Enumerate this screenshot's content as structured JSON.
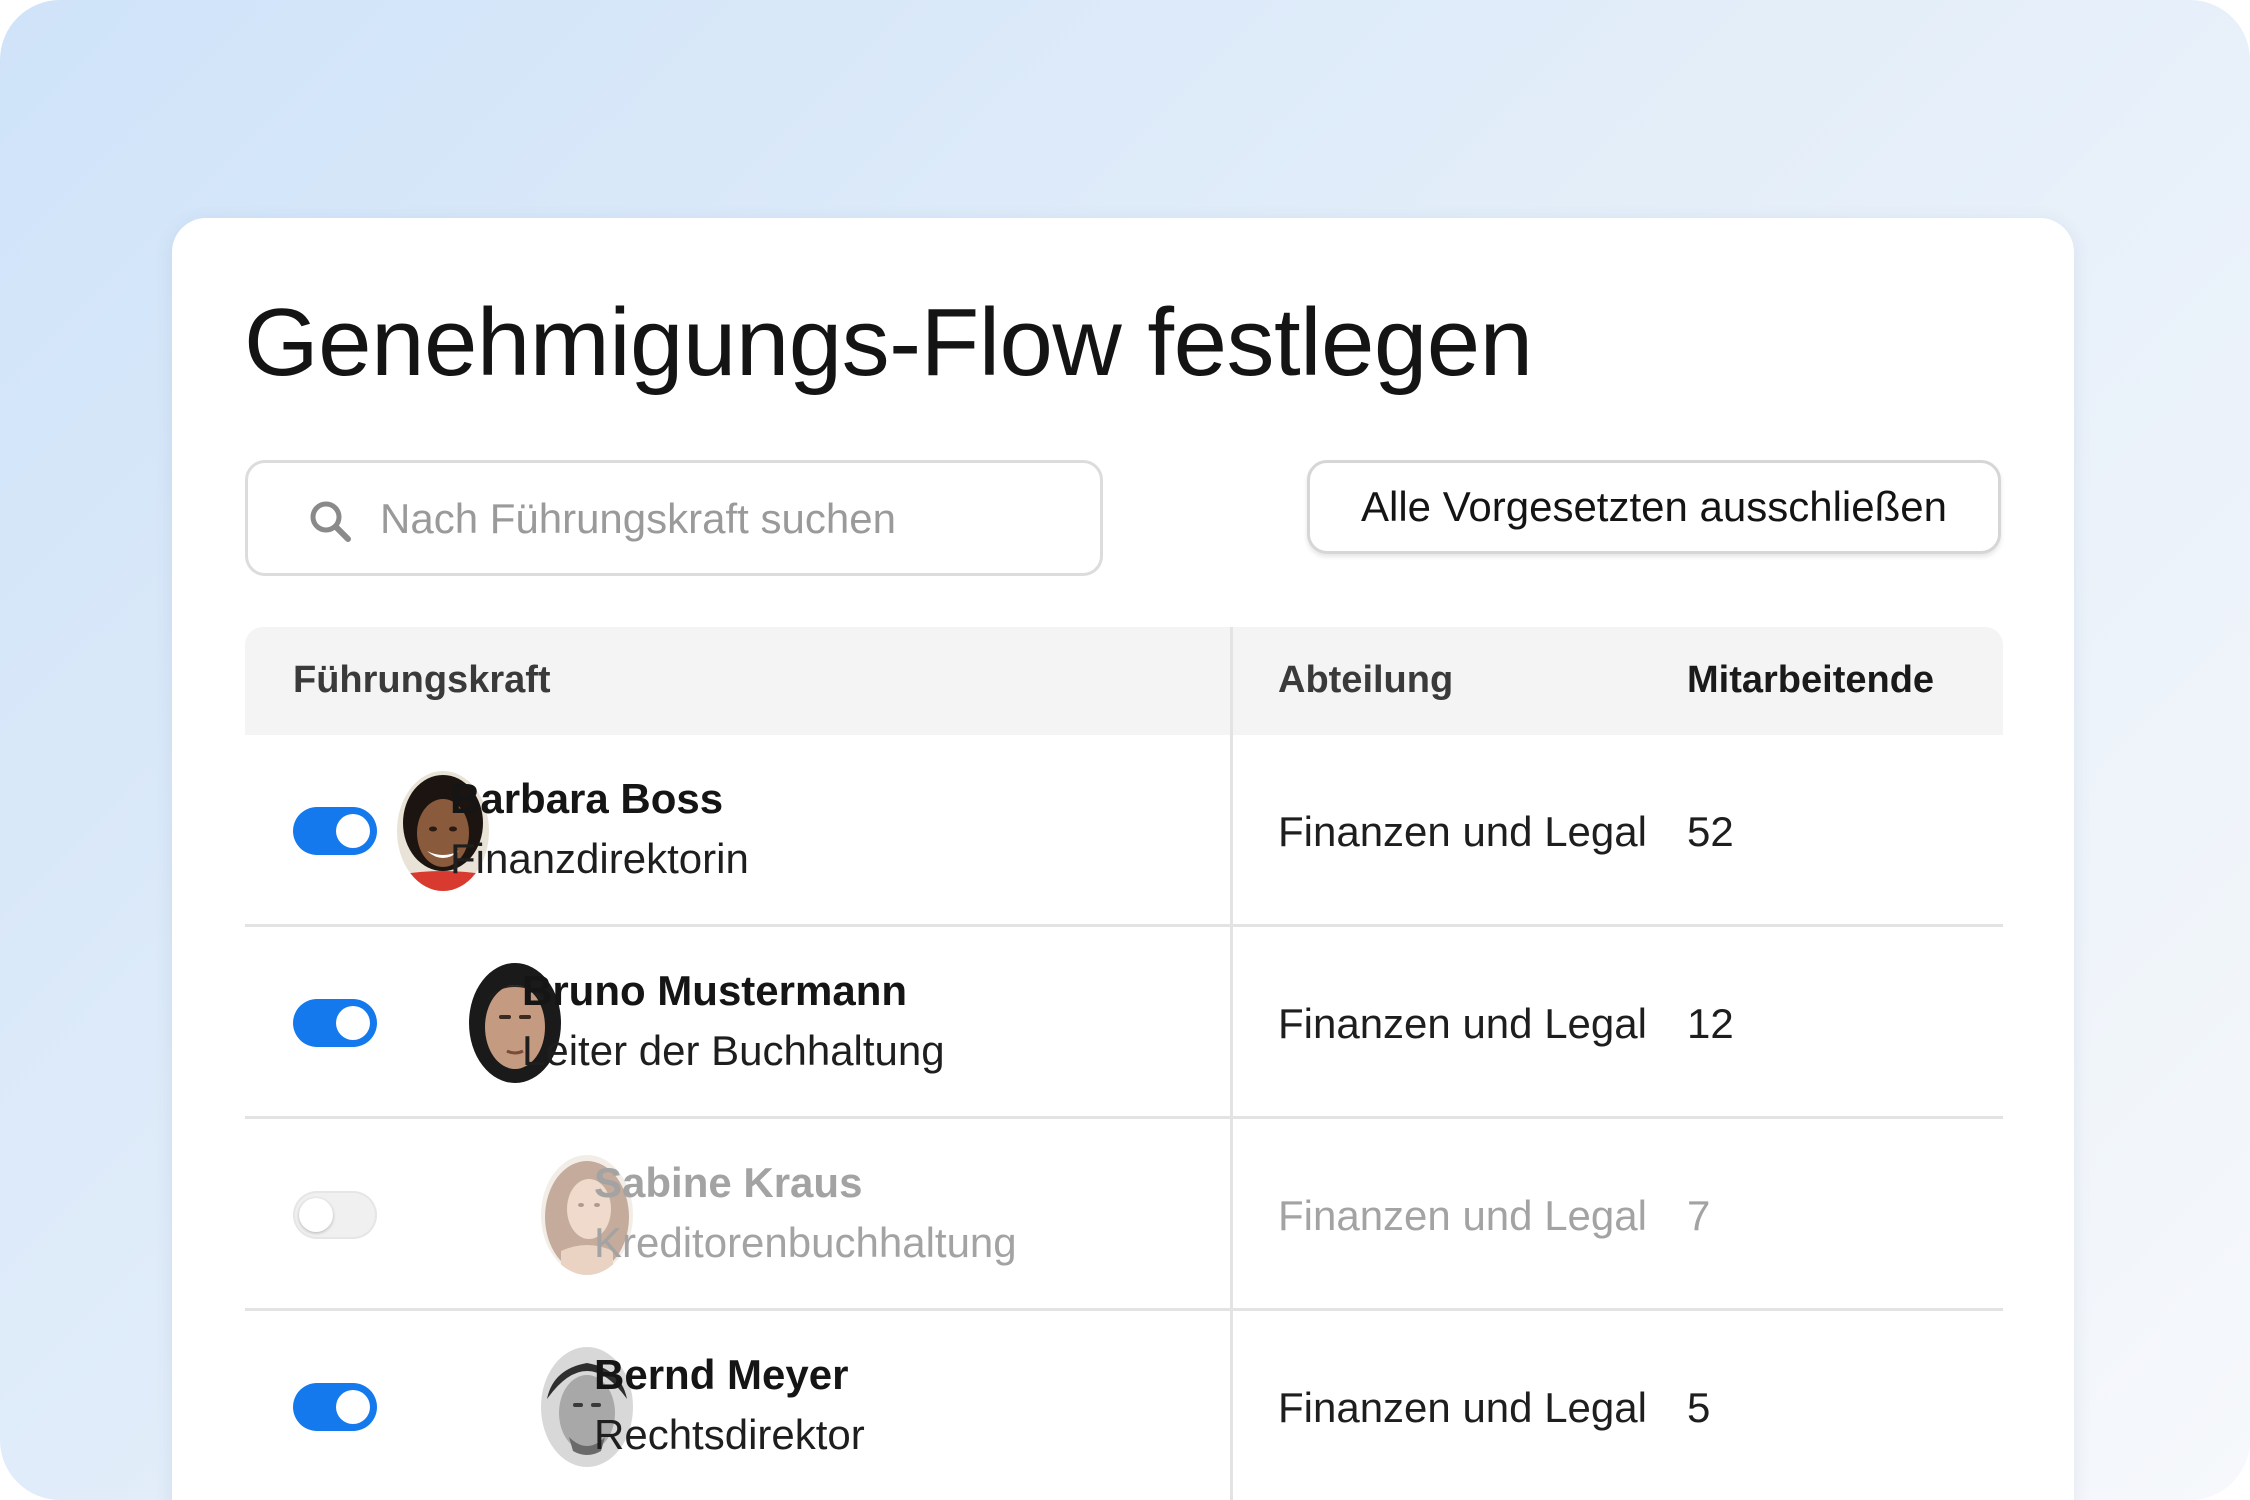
{
  "page": {
    "title": "Genehmigungs-Flow festlegen"
  },
  "search": {
    "placeholder": "Nach Führungskraft suchen",
    "value": ""
  },
  "actions": {
    "exclude_all_label": "Alle Vorgesetzten ausschließen"
  },
  "table": {
    "headers": {
      "manager": "Führungskraft",
      "department": "Abteilung",
      "employees": "Mitarbeitende"
    },
    "rows": [
      {
        "enabled": true,
        "name": "Barbara Boss",
        "role": "Finanzdirektorin",
        "department": "Finanzen und Legal",
        "employees": "52",
        "avatar": "avatar-barbara-boss",
        "indent_level": 0
      },
      {
        "enabled": true,
        "name": "Bruno Mustermann",
        "role": "Leiter der Buchhaltung",
        "department": "Finanzen und Legal",
        "employees": "12",
        "avatar": "avatar-bruno-mustermann",
        "indent_level": 1
      },
      {
        "enabled": false,
        "name": "Sabine Kraus",
        "role": "Kreditorenbuchhaltung",
        "department": "Finanzen und Legal",
        "employees": "7",
        "avatar": "avatar-sabine-kraus",
        "indent_level": 2
      },
      {
        "enabled": true,
        "name": "Bernd Meyer",
        "role": "Rechtsdirektor",
        "department": "Finanzen und Legal",
        "employees": "5",
        "avatar": "avatar-bernd-meyer",
        "indent_level": 2
      }
    ]
  },
  "icons": {
    "search": "search-icon"
  },
  "colors": {
    "accent": "#1479ec",
    "toggle_off": "#f0f0f0",
    "header_bg": "#f4f4f4",
    "disabled_text": "#a3a3a3"
  }
}
